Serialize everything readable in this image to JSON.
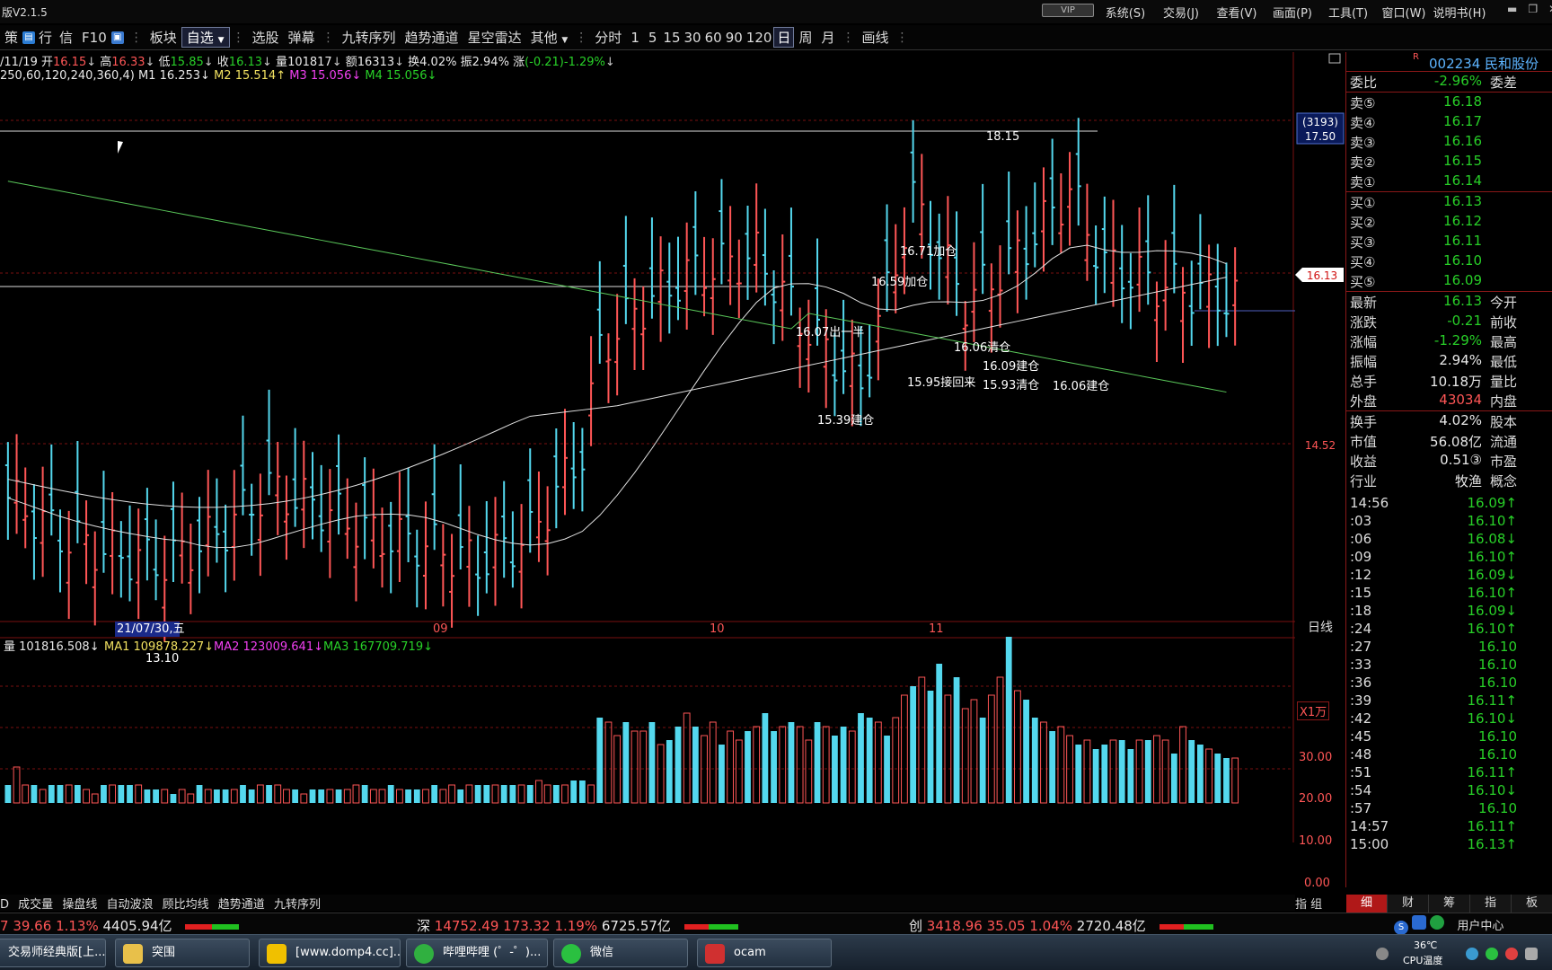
{
  "window": {
    "title": "版V2.1.5",
    "vip_label": "VIP",
    "menu": [
      "系统(S)",
      "交易(J)",
      "查看(V)",
      "画面(P)",
      "工具(T)",
      "窗口(W)",
      "说明书(H)"
    ]
  },
  "toolbar": {
    "items": [
      "策",
      "行",
      "信",
      "F10",
      "板块",
      "自选",
      "选股",
      "弹幕",
      "九转序列",
      "趋势通道",
      "星空雷达",
      "其他",
      "分时",
      "1",
      "5",
      "15",
      "30",
      "60",
      "90",
      "120",
      "日",
      "周",
      "月",
      "画线"
    ],
    "selected": "自选",
    "period_selected": "日"
  },
  "chart_header": {
    "date": "/11/19",
    "open_label": "开",
    "open": "16.15",
    "high_label": "高",
    "high": "16.33",
    "low_label": "低",
    "low": "15.85",
    "close_label": "收",
    "close": "16.13",
    "vol_label": "量",
    "vol": "101817",
    "amt_label": "额",
    "amt": "16313",
    "turnover_label": "换",
    "turnover": "4.02%",
    "amplitude_label": "振",
    "amplitude": "2.94%",
    "change_label": "涨",
    "change": "(-0.21)-1.29%",
    "ma_params": "250,60,120,240,360,4)",
    "m1": "M1 16.253↓",
    "m2": "M2 15.514↑",
    "m3": "M3 15.056↓",
    "m4": "M4 15.056↓"
  },
  "chart_data": {
    "type": "candlestick",
    "price_axis": {
      "labels": [
        "17.50",
        "16.13",
        "14.52"
      ],
      "marker": "(3193)"
    },
    "annotations": [
      "18.15",
      "13.10",
      "16.71加仓",
      "16.59加仓",
      "16.07出一半",
      "16.06清仓",
      "16.09建仓",
      "15.95接回来",
      "15.93清仓",
      "16.06建仓",
      "15.39建仓"
    ],
    "date_axis": [
      "21/07/30,五",
      "09",
      "10",
      "11"
    ],
    "period_label": "日线",
    "volume_header": {
      "vol": "量 101816.508↓",
      "ma1": "MA1 109878.227↓",
      "ma2": "MA2 123009.641↓",
      "ma3": "MA3 167709.719↓"
    },
    "volume_axis": [
      "X1万",
      "30.00",
      "20.00",
      "10.00",
      "0.00"
    ],
    "volumes": [
      4,
      8,
      4,
      4,
      3,
      4,
      4,
      4,
      4,
      3,
      2,
      4,
      4,
      4,
      4,
      4,
      3,
      3,
      3,
      2,
      3,
      2,
      4,
      3,
      3,
      3,
      3,
      4,
      3,
      4,
      4,
      4,
      3,
      3,
      2,
      3,
      3,
      3,
      3,
      3,
      4,
      4,
      3,
      3,
      4,
      3,
      3,
      3,
      3,
      4,
      3,
      4,
      3,
      4,
      4,
      4,
      4,
      4,
      4,
      4,
      4,
      5,
      4,
      4,
      4,
      5,
      5,
      4,
      19,
      18,
      15,
      18,
      16,
      16,
      18,
      13,
      14,
      17,
      20,
      17,
      15,
      18,
      13,
      16,
      14,
      16,
      17,
      20,
      16,
      17,
      18,
      17,
      14,
      18,
      17,
      15,
      17,
      16,
      20,
      19,
      18,
      15,
      19,
      24,
      26,
      28,
      25,
      31,
      24,
      28,
      21,
      23,
      19,
      24,
      28,
      37,
      25,
      23,
      19,
      18,
      16,
      17,
      15,
      13,
      14,
      12,
      13,
      14,
      14,
      12,
      14,
      14,
      15,
      14,
      11,
      17,
      14,
      13,
      12,
      11,
      10,
      10
    ],
    "price_range": [
      13.0,
      18.4
    ],
    "ma_values": {
      "m1": 16.253,
      "m2": 15.514,
      "m3": 15.056
    }
  },
  "quote": {
    "code": "002234 民和股份",
    "rows": [
      {
        "label": "委比",
        "value": "-2.96%",
        "label2": "委差",
        "color": "green"
      },
      {
        "label": "卖⑤",
        "value": "16.18",
        "color": "green"
      },
      {
        "label": "卖④",
        "value": "16.17",
        "color": "green"
      },
      {
        "label": "卖③",
        "value": "16.16",
        "color": "green"
      },
      {
        "label": "卖②",
        "value": "16.15",
        "color": "green"
      },
      {
        "label": "卖①",
        "value": "16.14",
        "color": "green"
      },
      {
        "label": "买①",
        "value": "16.13",
        "color": "green"
      },
      {
        "label": "买②",
        "value": "16.12",
        "color": "green"
      },
      {
        "label": "买③",
        "value": "16.11",
        "color": "green"
      },
      {
        "label": "买④",
        "value": "16.10",
        "color": "green"
      },
      {
        "label": "买⑤",
        "value": "16.09",
        "color": "green"
      },
      {
        "label": "最新",
        "value": "16.13",
        "label2": "今开",
        "color": "green"
      },
      {
        "label": "涨跌",
        "value": "-0.21",
        "label2": "前收",
        "color": "green"
      },
      {
        "label": "涨幅",
        "value": "-1.29%",
        "label2": "最高",
        "color": "green"
      },
      {
        "label": "振幅",
        "value": "2.94%",
        "label2": "最低",
        "color": "white"
      },
      {
        "label": "总手",
        "value": "10.18万",
        "label2": "量比",
        "color": "white"
      },
      {
        "label": "外盘",
        "value": "43034",
        "label2": "内盘",
        "color": "red"
      },
      {
        "label": "换手",
        "value": "4.02%",
        "label2": "股本",
        "color": "white"
      },
      {
        "label": "市值",
        "value": "56.08亿",
        "label2": "流通",
        "color": "white"
      },
      {
        "label": "收益",
        "value": "0.51③",
        "label2": "市盈",
        "color": "white"
      },
      {
        "label": "行业",
        "value": "牧渔",
        "label2": "概念",
        "color": "white"
      }
    ],
    "ticks": [
      {
        "time": "14:56",
        "price": "16.09↑",
        "color": "green"
      },
      {
        "time": ":03",
        "price": "16.10↑",
        "color": "green"
      },
      {
        "time": ":06",
        "price": "16.08↓",
        "color": "green"
      },
      {
        "time": ":09",
        "price": "16.10↑",
        "color": "green"
      },
      {
        "time": ":12",
        "price": "16.09↓",
        "color": "green"
      },
      {
        "time": ":15",
        "price": "16.10↑",
        "color": "green"
      },
      {
        "time": ":18",
        "price": "16.09↓",
        "color": "green"
      },
      {
        "time": ":24",
        "price": "16.10↑",
        "color": "green"
      },
      {
        "time": ":27",
        "price": "16.10",
        "color": "green"
      },
      {
        "time": ":33",
        "price": "16.10",
        "color": "green"
      },
      {
        "time": ":36",
        "price": "16.10",
        "color": "green"
      },
      {
        "time": ":39",
        "price": "16.11↑",
        "color": "green"
      },
      {
        "time": ":42",
        "price": "16.10↓",
        "color": "green"
      },
      {
        "time": ":45",
        "price": "16.10",
        "color": "green"
      },
      {
        "time": ":48",
        "price": "16.10",
        "color": "green"
      },
      {
        "time": ":51",
        "price": "16.11↑",
        "color": "green"
      },
      {
        "time": ":54",
        "price": "16.10↓",
        "color": "green"
      },
      {
        "time": ":57",
        "price": "16.10",
        "color": "green"
      },
      {
        "time": "14:57",
        "price": "16.11↑",
        "color": "green"
      },
      {
        "time": "15:00",
        "price": "16.13↑",
        "color": "green"
      }
    ],
    "tabs": [
      "细",
      "财",
      "筹",
      "指",
      "板"
    ]
  },
  "indicator_tabs": [
    "D",
    "成交量",
    "操盘线",
    "自动波浪",
    "顾比均线",
    "趋势通道",
    "九转序列"
  ],
  "index_group": "指 组",
  "status": {
    "sh": {
      "prefix": "7",
      "change": "39.66",
      "pct": "1.13%",
      "amount": "4405.94亿"
    },
    "sz": {
      "name": "深",
      "index": "14752.49",
      "change": "173.32",
      "pct": "1.19%",
      "amount": "6725.57亿"
    },
    "cy": {
      "name": "创",
      "index": "3418.96",
      "change": "35.05",
      "pct": "1.04%",
      "amount": "2720.48亿"
    }
  },
  "taskbar": {
    "tasks": [
      "交易师经典版[上...",
      "突围",
      "[www.domp4.cc]...",
      "哔哩哔哩 (゜-゜)...",
      "微信",
      "ocam"
    ],
    "tray_user": "用户中心",
    "temp": "36℃",
    "cpu": "CPU温度"
  },
  "colors": {
    "up": "#ff5656",
    "down": "#28d028",
    "candle_down": "#54d8ee",
    "grid": "#7a1010",
    "ma_white": "#e0e0e0",
    "ma_green": "#5ac85a"
  }
}
